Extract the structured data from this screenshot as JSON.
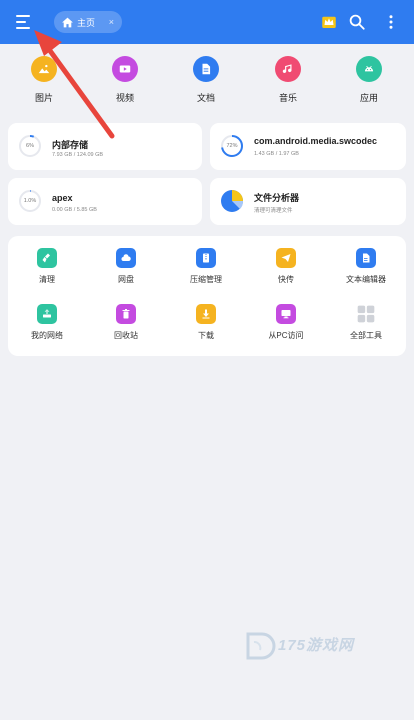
{
  "header": {
    "tab_label": "主页",
    "tab_close": "×",
    "icons": [
      "menu-icon",
      "home-icon",
      "crown-icon",
      "search-icon",
      "more-vertical-icon"
    ]
  },
  "categories": [
    {
      "label": "图片",
      "icon": "image-icon",
      "color": "#f5b320"
    },
    {
      "label": "视频",
      "icon": "video-icon",
      "color": "#c44be0"
    },
    {
      "label": "文档",
      "icon": "document-icon",
      "color": "#2f7cf0"
    },
    {
      "label": "音乐",
      "icon": "music-icon",
      "color": "#f04b72"
    },
    {
      "label": "应用",
      "icon": "android-icon",
      "color": "#2ec4a0"
    }
  ],
  "storage": {
    "internal": {
      "title": "内部存储",
      "sub": "7.93 GB / 124.09 GB",
      "percent_label": "6%",
      "percent": 6
    },
    "swcodec": {
      "title": "com.android.media.swcodec",
      "sub": "1.43 GB / 1.97 GB",
      "percent_label": "72%",
      "percent": 72
    },
    "apex": {
      "title": "apex",
      "sub": "0.00 GB / 5.85 GB",
      "percent_label": "1.0%",
      "percent": 1
    },
    "analyzer": {
      "title": "文件分析器",
      "sub": "清理可清理文件"
    }
  },
  "tools": [
    {
      "label": "清理",
      "icon": "broom-icon",
      "color": "#2ec4a0"
    },
    {
      "label": "网盘",
      "icon": "cloud-icon",
      "color": "#2f7cf0"
    },
    {
      "label": "压缩管理",
      "icon": "zip-icon",
      "color": "#2f7cf0"
    },
    {
      "label": "快传",
      "icon": "send-icon",
      "color": "#f5b320"
    },
    {
      "label": "文本编辑器",
      "icon": "text-file-icon",
      "color": "#2f7cf0"
    },
    {
      "label": "我的网络",
      "icon": "network-icon",
      "color": "#2ec4a0"
    },
    {
      "label": "回收站",
      "icon": "trash-icon",
      "color": "#c44be0"
    },
    {
      "label": "下载",
      "icon": "download-icon",
      "color": "#f5b320"
    },
    {
      "label": "从PC访问",
      "icon": "pc-icon",
      "color": "#c44be0"
    },
    {
      "label": "全部工具",
      "icon": "grid-icon",
      "color": "#cfd2d8"
    }
  ],
  "colors": {
    "accent": "#2f7cf0",
    "background": "#f0f1f5",
    "annotation": "#e8453c"
  },
  "watermark": {
    "text": "175游戏网"
  }
}
